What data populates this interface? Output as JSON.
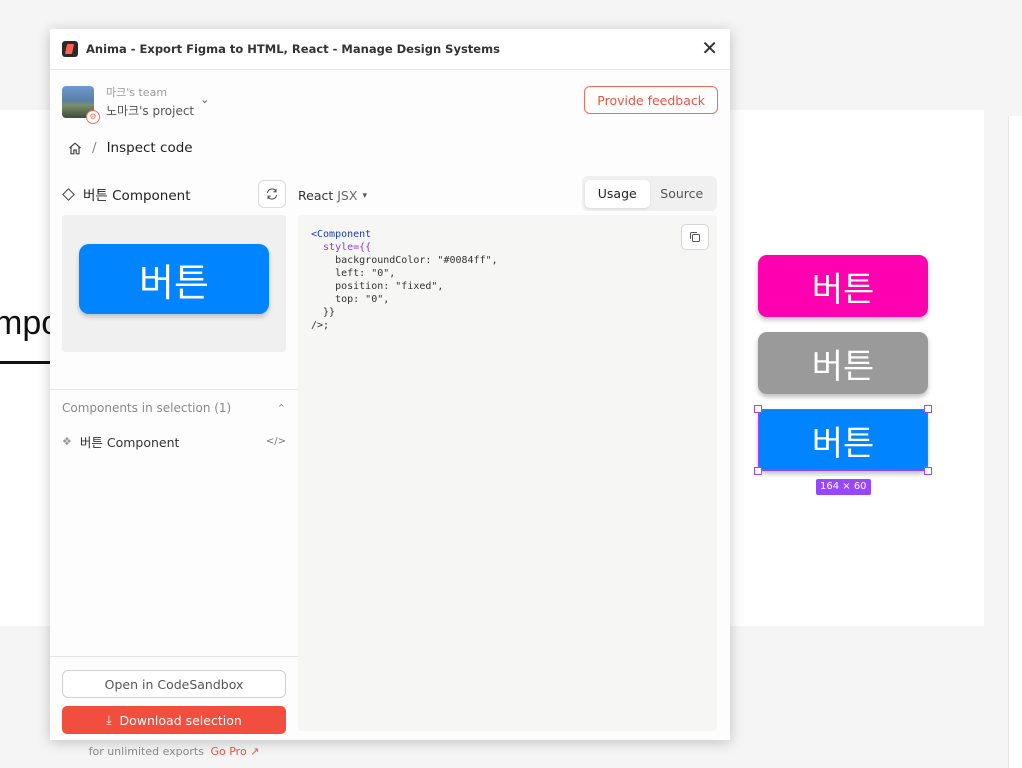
{
  "canvas": {
    "partial_text": "mpo",
    "buttons": [
      {
        "label": "버튼",
        "color": "#ff00b0"
      },
      {
        "label": "버튼",
        "color": "#9a9a9a"
      },
      {
        "label": "버튼",
        "color": "#0084ff"
      }
    ],
    "selection_size": "164 × 60",
    "selection_color": "#9747ff"
  },
  "plugin": {
    "title": "Anima - Export Figma to HTML, React - Manage Design Systems",
    "close_icon": "close-icon",
    "team_name": "마크's team",
    "project_name": "노마크's project",
    "feedback_label": "Provide feedback",
    "breadcrumb": {
      "home_icon": "home-icon",
      "separator": "/",
      "current": "Inspect code"
    },
    "component_title": "버튼 Component",
    "preview_button_label": "버튼",
    "preview_button_color": "#0084ff",
    "framework": {
      "name": "React",
      "variant": "JSX"
    },
    "tabs": [
      {
        "label": "Usage",
        "active": true
      },
      {
        "label": "Source",
        "active": false
      }
    ],
    "code_lines": [
      "<Component",
      "  style={{",
      "    backgroundColor: \"#0084ff\",",
      "    left: \"0\",",
      "    position: \"fixed\",",
      "    top: \"0\",",
      "  }}",
      "/>;"
    ],
    "selection_header": "Components in selection (1)",
    "selection_items": [
      {
        "label": "버튼 Component"
      }
    ],
    "sandbox_label": "Open in CodeSandbox",
    "download_label": "Download selection",
    "gopro_text": "for unlimited exports",
    "gopro_link": "Go Pro",
    "accent_color": "#f24e3e"
  }
}
